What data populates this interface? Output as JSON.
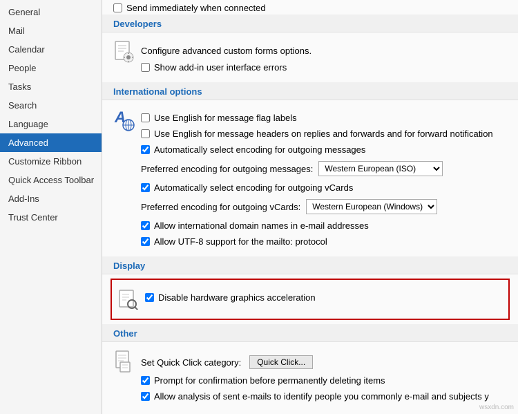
{
  "sidebar": {
    "items": [
      {
        "label": "General",
        "active": false
      },
      {
        "label": "Mail",
        "active": false
      },
      {
        "label": "Calendar",
        "active": false
      },
      {
        "label": "People",
        "active": false
      },
      {
        "label": "Tasks",
        "active": false
      },
      {
        "label": "Search",
        "active": false
      },
      {
        "label": "Language",
        "active": false
      },
      {
        "label": "Advanced",
        "active": true
      },
      {
        "label": "Customize Ribbon",
        "active": false
      },
      {
        "label": "Quick Access Toolbar",
        "active": false
      },
      {
        "label": "Add-Ins",
        "active": false
      },
      {
        "label": "Trust Center",
        "active": false
      }
    ]
  },
  "main": {
    "send_label": "Send immediately when connected",
    "sections": {
      "developers": {
        "header": "Developers",
        "options": [
          {
            "type": "text",
            "text": "Configure advanced custom forms options."
          },
          {
            "type": "checkbox",
            "checked": false,
            "label": "Show add-in user interface errors"
          }
        ]
      },
      "international": {
        "header": "International options",
        "options": [
          {
            "type": "checkbox",
            "checked": false,
            "label": "Use English for message flag labels"
          },
          {
            "type": "checkbox",
            "checked": false,
            "label": "Use English for message headers on replies and forwards and for forward notification"
          },
          {
            "type": "checkbox",
            "checked": true,
            "label": "Automatically select encoding for outgoing messages"
          },
          {
            "type": "dropdown",
            "label": "Preferred encoding for outgoing messages:",
            "value": "Western European (ISO)"
          },
          {
            "type": "checkbox",
            "checked": true,
            "label": "Automatically select encoding for outgoing vCards"
          },
          {
            "type": "dropdown",
            "label": "Preferred encoding for outgoing vCards:",
            "value": "Western European (Windows)"
          },
          {
            "type": "checkbox",
            "checked": true,
            "label": "Allow international domain names in e-mail addresses"
          },
          {
            "type": "checkbox",
            "checked": true,
            "label": "Allow UTF-8 support for the mailto: protocol"
          }
        ]
      },
      "display": {
        "header": "Display",
        "options": [
          {
            "type": "checkbox",
            "checked": true,
            "label": "Disable hardware graphics acceleration"
          }
        ]
      },
      "other": {
        "header": "Other",
        "options": [
          {
            "type": "quickclick",
            "label": "Set Quick Click category:",
            "button": "Quick Click..."
          },
          {
            "type": "checkbox",
            "checked": true,
            "label": "Prompt for confirmation before permanently deleting items"
          },
          {
            "type": "checkbox",
            "checked": true,
            "label": "Allow analysis of sent e-mails to identify people you commonly e-mail and subjects y"
          }
        ]
      }
    }
  },
  "watermark": "wsxdn.com"
}
